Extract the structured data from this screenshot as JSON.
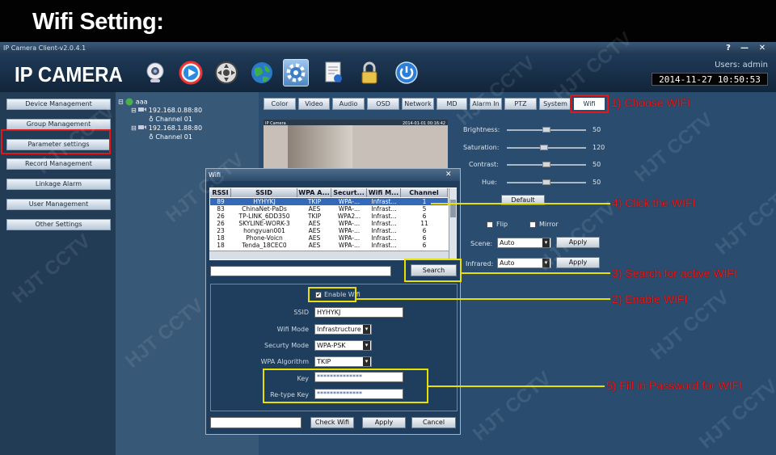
{
  "banner": {
    "title": "Wifi Setting:"
  },
  "window": {
    "title": "IP Camera Client-v2.0.4.1",
    "help": "?",
    "minimize": "—",
    "close": "✕"
  },
  "header": {
    "logo": "IP CAMERA",
    "users": "Users: admin",
    "clock": "2014-11-27  10:50:53"
  },
  "nav": [
    "Device Management",
    "Group Management",
    "Parameter settings",
    "Record Management",
    "Linkage Alarm",
    "User Management",
    "Other Settings"
  ],
  "tree": {
    "root": "aaa",
    "devices": [
      {
        "ip": "192.168.0.88:80",
        "channel": "Channel 01"
      },
      {
        "ip": "192.168.1.88:80",
        "channel": "Channel 01"
      }
    ]
  },
  "tabs": [
    "Color",
    "Video",
    "Audio",
    "OSD",
    "Network",
    "MD",
    "Alarm In",
    "PTZ",
    "System",
    "Wifi"
  ],
  "video": {
    "label": "IP Camera",
    "timestamp": "2014-01-01 00:16:42"
  },
  "image_settings": {
    "sliders": [
      {
        "label": "Brightness:",
        "value": "50",
        "level": 0.5
      },
      {
        "label": "Saturation:",
        "value": "120",
        "level": 0.47
      },
      {
        "label": "Contrast:",
        "value": "50",
        "level": 0.5
      },
      {
        "label": "Hue:",
        "value": "50",
        "level": 0.5
      }
    ],
    "default_label": "Default",
    "flip": "Flip",
    "mirror": "Mirror",
    "scene_label": "Scene:",
    "scene_value": "Auto",
    "infrared_label": "Infrared:",
    "infrared_value": "Auto",
    "apply_label": "Apply"
  },
  "wifi_dialog": {
    "title": "Wifi",
    "close": "✕",
    "columns": [
      "RSSI",
      "SSID",
      "WPA A...",
      "Securt...",
      "Wifi M...",
      "Channel"
    ],
    "rows": [
      [
        "89",
        "HYHYKJ",
        "TKIP",
        "WPA-...",
        "Infrast...",
        "1"
      ],
      [
        "83",
        "ChinaNet-PaDs",
        "AES",
        "WPA-...",
        "Infrast...",
        "5"
      ],
      [
        "26",
        "TP-LINK_6DD350",
        "TKIP",
        "WPA2...",
        "Infrast...",
        "6"
      ],
      [
        "26",
        "SKYLINE-WORK-3",
        "AES",
        "WPA-...",
        "Infrast...",
        "11"
      ],
      [
        "23",
        "hongyuan001",
        "AES",
        "WPA-...",
        "Infrast...",
        "6"
      ],
      [
        "18",
        "Phone-Voicn",
        "AES",
        "WPA-...",
        "Infrast...",
        "6"
      ],
      [
        "18",
        "Tenda_18CEC0",
        "AES",
        "WPA-...",
        "Infrast...",
        "6"
      ]
    ],
    "search_label": "Search",
    "enable_label": "Enable Wifi",
    "ssid_label": "SSID",
    "ssid_value": "HYHYKJ",
    "mode_label": "Wifi Mode",
    "mode_value": "Infrastructure",
    "security_label": "Securty Mode",
    "security_value": "WPA-PSK",
    "algorithm_label": "WPA Algorithm",
    "algorithm_value": "TKIP",
    "key_label": "Key",
    "key_value": "**************",
    "retype_label": "Re-type Key",
    "retype_value": "**************",
    "check_label": "Check Wifi",
    "apply_label": "Apply",
    "cancel_label": "Cancel"
  },
  "annotations": {
    "step1": "1) Choose WIFI",
    "step2": "2) Enable WIFI",
    "step3": "3) Search for active WIFI",
    "step4": "4) Click the WIFI",
    "step5": "5) Fill in Password for WIFI"
  },
  "watermark": "HJT CCTV",
  "colors": {
    "annotation": "#e81a1a",
    "highlight": "#e8e000",
    "selected_row": "#3468b8"
  }
}
